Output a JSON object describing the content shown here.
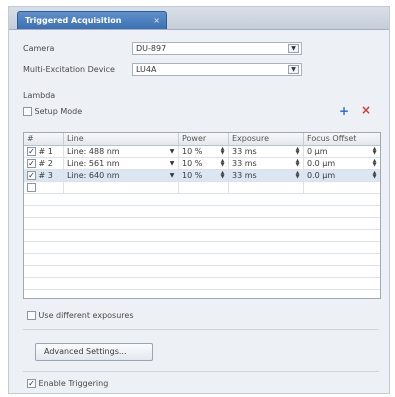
{
  "tab": {
    "title": "Triggered Acquisition",
    "close": "×"
  },
  "form": {
    "camera_label": "Camera",
    "camera_value": "DU-897",
    "device_label": "Multi-Excitation Device",
    "device_value": "LU4A"
  },
  "lambda": {
    "section_label": "Lambda",
    "setup_mode_label": "Setup Mode",
    "add_symbol": "+",
    "remove_symbol": "×"
  },
  "grid": {
    "columns": [
      "#",
      "Line",
      "Power",
      "Exposure",
      "Focus Offset"
    ],
    "rows": [
      {
        "checked": true,
        "index": "# 1",
        "line": "Line: 488 nm",
        "power": "10 %",
        "exposure": "33 ms",
        "focus": "0 µm"
      },
      {
        "checked": true,
        "index": "# 2",
        "line": "Line: 561 nm",
        "power": "10 %",
        "exposure": "33 ms",
        "focus": "0.0 µm"
      },
      {
        "checked": true,
        "index": "# 3",
        "line": "Line: 640 nm",
        "power": "10 %",
        "exposure": "33 ms",
        "focus": "0.0 µm"
      }
    ]
  },
  "options": {
    "different_exposures_label": "Use different exposures",
    "advanced_button": "Advanced Settings...",
    "enable_triggering_label": "Enable Triggering",
    "enable_triggering_checked": true
  },
  "colors": {
    "tab_active": "#3c6fb2",
    "remove": "#d23a2f",
    "add": "#2f6fd0"
  },
  "icons": {
    "add": "plus-icon",
    "remove": "remove-icon",
    "dropdown": "chevron-down-icon",
    "spinner": "spinner-icon"
  }
}
